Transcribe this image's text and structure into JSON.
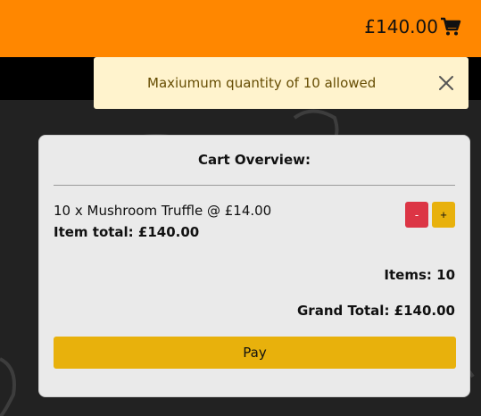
{
  "header": {
    "cart_total": "£140.00",
    "cart_icon": "shopping-cart-icon",
    "accent_color": "#ff8700"
  },
  "toast": {
    "message": "Maxiumum quantity of 10 allowed",
    "close_icon": "close-icon"
  },
  "cart": {
    "title": "Cart Overview:",
    "line_item": "10 x Mushroom Truffle @ £14.00",
    "item_total": "Item total: £140.00",
    "minus_label": "-",
    "plus_label": "+",
    "items_count": "Items: 10",
    "grand_total": "Grand Total: £140.00",
    "pay_label": "Pay"
  }
}
